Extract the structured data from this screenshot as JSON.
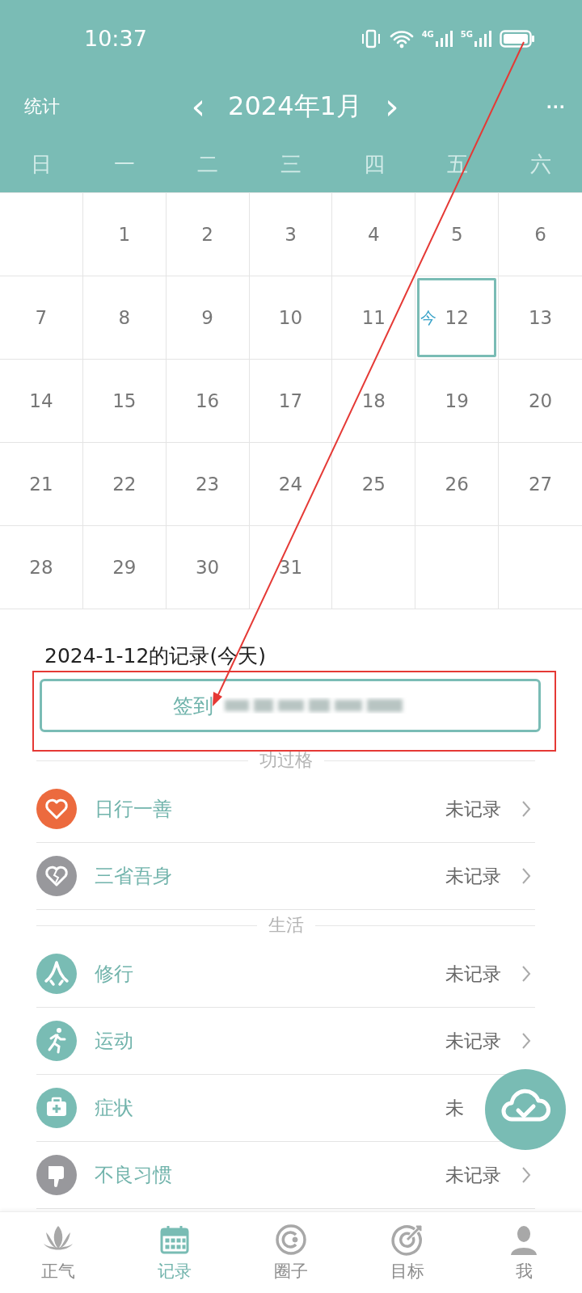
{
  "status_bar": {
    "time": "10:37",
    "network_labels": [
      "4G",
      "5G"
    ]
  },
  "header": {
    "left": "统计",
    "prev": "‹",
    "month": "2024年1月",
    "next": "›",
    "more": "···"
  },
  "weekdays": [
    "日",
    "一",
    "二",
    "三",
    "四",
    "五",
    "六"
  ],
  "calendar": {
    "weeks": [
      [
        {
          "kind": "blank"
        },
        {
          "kind": "day",
          "day": "1",
          "selected": false
        },
        {
          "kind": "day",
          "day": "2",
          "selected": false
        },
        {
          "kind": "day",
          "day": "3",
          "selected": false
        },
        {
          "kind": "day",
          "day": "4",
          "selected": false
        },
        {
          "kind": "day",
          "day": "5",
          "selected": false
        },
        {
          "kind": "day",
          "day": "6",
          "selected": false
        }
      ],
      [
        {
          "kind": "day",
          "day": "7",
          "selected": false
        },
        {
          "kind": "day",
          "day": "8",
          "selected": false
        },
        {
          "kind": "day",
          "day": "9",
          "selected": false
        },
        {
          "kind": "day",
          "day": "10",
          "selected": false
        },
        {
          "kind": "day",
          "day": "11",
          "selected": false
        },
        {
          "kind": "day",
          "day": "12",
          "selected": true,
          "today_mark": "今"
        },
        {
          "kind": "day",
          "day": "13",
          "selected": false
        }
      ],
      [
        {
          "kind": "day",
          "day": "14",
          "selected": false
        },
        {
          "kind": "day",
          "day": "15",
          "selected": false
        },
        {
          "kind": "day",
          "day": "16",
          "selected": false
        },
        {
          "kind": "day",
          "day": "17",
          "selected": false
        },
        {
          "kind": "day",
          "day": "18",
          "selected": false
        },
        {
          "kind": "day",
          "day": "19",
          "selected": false
        },
        {
          "kind": "day",
          "day": "20",
          "selected": false
        }
      ],
      [
        {
          "kind": "day",
          "day": "21",
          "selected": false
        },
        {
          "kind": "day",
          "day": "22",
          "selected": false
        },
        {
          "kind": "day",
          "day": "23",
          "selected": false
        },
        {
          "kind": "day",
          "day": "24",
          "selected": false
        },
        {
          "kind": "day",
          "day": "25",
          "selected": false
        },
        {
          "kind": "day",
          "day": "26",
          "selected": false
        },
        {
          "kind": "day",
          "day": "27",
          "selected": false
        }
      ],
      [
        {
          "kind": "day",
          "day": "28",
          "selected": false
        },
        {
          "kind": "day",
          "day": "29",
          "selected": false
        },
        {
          "kind": "day",
          "day": "30",
          "selected": false
        },
        {
          "kind": "day",
          "day": "31",
          "selected": false
        },
        {
          "kind": "blank"
        },
        {
          "kind": "blank"
        },
        {
          "kind": "blank"
        }
      ]
    ]
  },
  "record": {
    "title": "2024-1-12的记录(今天)",
    "checkin_button": "签到"
  },
  "sections": [
    {
      "title": "功过格",
      "items": [
        {
          "kind": "heart",
          "color": "#ec6a3e",
          "label": "日行一善",
          "status": "未记录",
          "chevron": true
        },
        {
          "kind": "broken-heart",
          "color": "#98989c",
          "label": "三省吾身",
          "status": "未记录",
          "chevron": true
        }
      ]
    },
    {
      "title": "生活",
      "items": [
        {
          "kind": "hands",
          "color": "#79bcb4",
          "label": "修行",
          "status": "未记录",
          "chevron": true
        },
        {
          "kind": "runner",
          "color": "#79bcb4",
          "label": "运动",
          "status": "未记录",
          "chevron": true
        },
        {
          "kind": "medkit",
          "color": "#79bcb4",
          "label": "症状",
          "status": "未",
          "chevron": false
        },
        {
          "kind": "thumbs-down",
          "color": "#98989c",
          "label": "不良习惯",
          "status": "未记录",
          "chevron": true
        }
      ]
    }
  ],
  "bottom_nav": [
    {
      "kind": "lotus",
      "label": "正气",
      "selected": false
    },
    {
      "kind": "calendar",
      "label": "记录",
      "selected": true
    },
    {
      "kind": "circle",
      "label": "圈子",
      "selected": false
    },
    {
      "kind": "target",
      "label": "目标",
      "selected": false
    },
    {
      "kind": "person",
      "label": "我",
      "selected": false
    }
  ]
}
